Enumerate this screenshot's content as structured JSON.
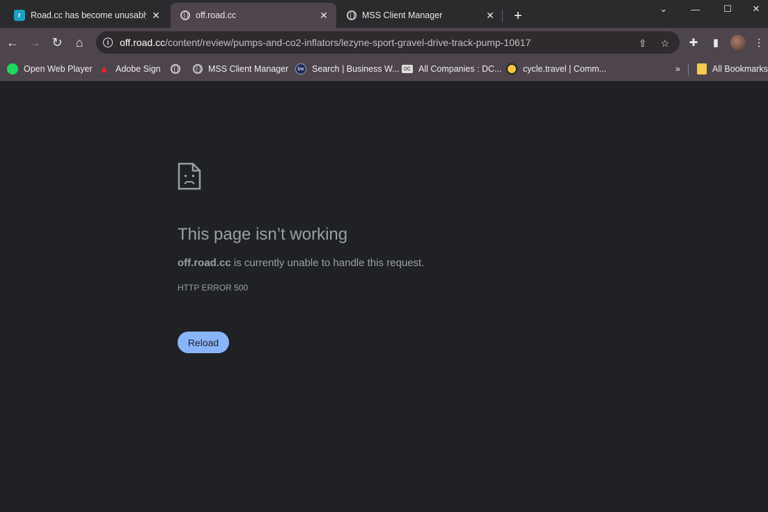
{
  "tabs": [
    {
      "title": "Road.cc has become unusably slow",
      "icon": "roadcc-favicon",
      "active": false
    },
    {
      "title": "off.road.cc",
      "icon": "globe-icon",
      "active": true
    },
    {
      "title": "MSS Client Manager",
      "icon": "globe-icon",
      "active": false
    }
  ],
  "omnibox": {
    "host": "off.road.cc",
    "path": "/content/review/pumps-and-co2-inflators/lezyne-sport-gravel-drive-track-pump-10617"
  },
  "bookmarks": [
    {
      "label": "Open Web Player",
      "icon": "spotify-icon"
    },
    {
      "label": "Adobe Sign",
      "icon": "adobe-icon"
    },
    {
      "label": "",
      "icon": "globe-icon"
    },
    {
      "label": "MSS Client Manager",
      "icon": "globe-icon"
    },
    {
      "label": "Search | Business W...",
      "icon": "businesswire-icon"
    },
    {
      "label": "All Companies : DC...",
      "icon": "dc-icon"
    },
    {
      "label": "cycle.travel | Comm...",
      "icon": "cycletravel-icon"
    }
  ],
  "bookmarks_overflow": "»",
  "all_bookmarks": "All Bookmarks",
  "error": {
    "title": "This page isn’t working",
    "host": "off.road.cc",
    "message": " is currently unable to handle this request.",
    "code": "HTTP ERROR 500",
    "reload_label": "Reload"
  },
  "colors": {
    "page_bg": "#202124",
    "toolbar_bg": "#4e454c",
    "reload_button": "#8ab4f8",
    "error_text": "#9aa0a6"
  }
}
